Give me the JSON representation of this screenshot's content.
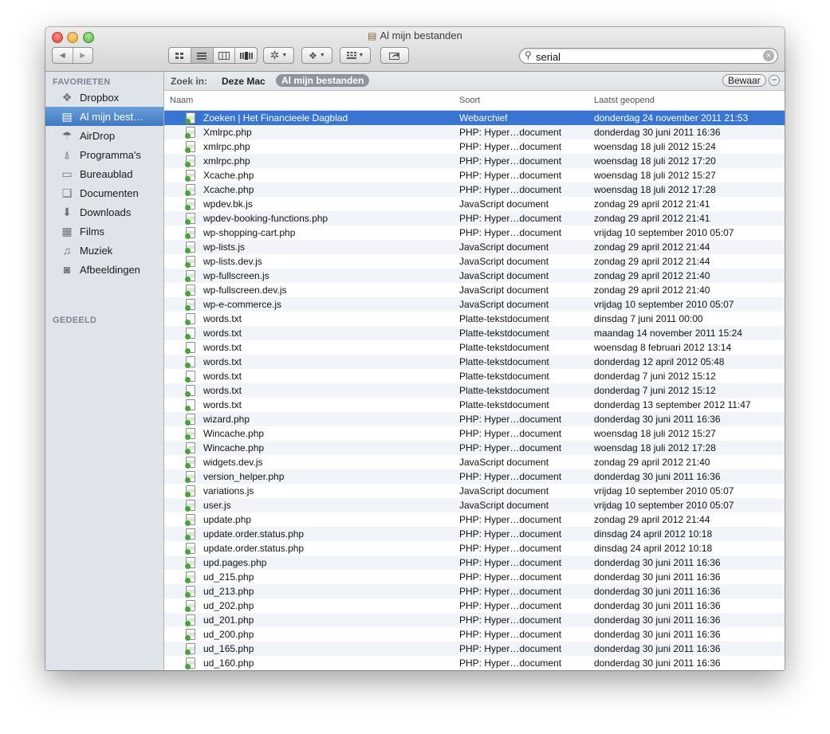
{
  "window": {
    "title": "Al mijn bestanden",
    "title_icon": "all-my-files-icon"
  },
  "toolbar": {
    "back": "◀",
    "forward": "▶",
    "view_icons": [
      "icon-view-icon",
      "list-view-icon",
      "column-view-icon",
      "coverflow-view-icon"
    ],
    "action": "action-gear-icon",
    "dropbox": "dropbox-icon",
    "arrange": "arrange-icon",
    "share": "share-icon"
  },
  "search": {
    "value": "serial",
    "placeholder": ""
  },
  "sidebar": {
    "favorites_header": "FAVORIETEN",
    "shared_header": "GEDEELD",
    "items": [
      {
        "label": "Dropbox",
        "icon": "dropbox-icon"
      },
      {
        "label": "Al mijn best…",
        "icon": "all-my-files-icon"
      },
      {
        "label": "AirDrop",
        "icon": "airdrop-icon"
      },
      {
        "label": "Programma's",
        "icon": "applications-icon"
      },
      {
        "label": "Bureaublad",
        "icon": "desktop-icon"
      },
      {
        "label": "Documenten",
        "icon": "documents-icon"
      },
      {
        "label": "Downloads",
        "icon": "downloads-icon"
      },
      {
        "label": "Films",
        "icon": "movies-icon"
      },
      {
        "label": "Muziek",
        "icon": "music-icon"
      },
      {
        "label": "Afbeeldingen",
        "icon": "pictures-icon"
      }
    ]
  },
  "scope": {
    "label": "Zoek in:",
    "option1": "Deze Mac",
    "option2": "Al mijn bestanden",
    "save": "Bewaar",
    "remove": "−"
  },
  "columns": {
    "name": "Naam",
    "kind": "Soort",
    "opened": "Laatst geopend"
  },
  "files": [
    {
      "name": "Zoeken | Het Financieele Dagblad",
      "kind": "Webarchief",
      "opened": "donderdag 24 november 2011 21:53"
    },
    {
      "name": "Xmlrpc.php",
      "kind": "PHP: Hyper…document",
      "opened": "donderdag 30 juni 2011 16:36"
    },
    {
      "name": "xmlrpc.php",
      "kind": "PHP: Hyper…document",
      "opened": "woensdag 18 juli 2012 15:24"
    },
    {
      "name": "xmlrpc.php",
      "kind": "PHP: Hyper…document",
      "opened": "woensdag 18 juli 2012 17:20"
    },
    {
      "name": "Xcache.php",
      "kind": "PHP: Hyper…document",
      "opened": "woensdag 18 juli 2012 15:27"
    },
    {
      "name": "Xcache.php",
      "kind": "PHP: Hyper…document",
      "opened": "woensdag 18 juli 2012 17:28"
    },
    {
      "name": "wpdev.bk.js",
      "kind": "JavaScript document",
      "opened": "zondag 29 april 2012 21:41"
    },
    {
      "name": "wpdev-booking-functions.php",
      "kind": "PHP: Hyper…document",
      "opened": "zondag 29 april 2012 21:41"
    },
    {
      "name": "wp-shopping-cart.php",
      "kind": "PHP: Hyper…document",
      "opened": "vrijdag 10 september 2010 05:07"
    },
    {
      "name": "wp-lists.js",
      "kind": "JavaScript document",
      "opened": "zondag 29 april 2012 21:44"
    },
    {
      "name": "wp-lists.dev.js",
      "kind": "JavaScript document",
      "opened": "zondag 29 april 2012 21:44"
    },
    {
      "name": "wp-fullscreen.js",
      "kind": "JavaScript document",
      "opened": "zondag 29 april 2012 21:40"
    },
    {
      "name": "wp-fullscreen.dev.js",
      "kind": "JavaScript document",
      "opened": "zondag 29 april 2012 21:40"
    },
    {
      "name": "wp-e-commerce.js",
      "kind": "JavaScript document",
      "opened": "vrijdag 10 september 2010 05:07"
    },
    {
      "name": "words.txt",
      "kind": "Platte-tekstdocument",
      "opened": "dinsdag 7 juni 2011 00:00"
    },
    {
      "name": "words.txt",
      "kind": "Platte-tekstdocument",
      "opened": "maandag 14 november 2011 15:24"
    },
    {
      "name": "words.txt",
      "kind": "Platte-tekstdocument",
      "opened": "woensdag 8 februari 2012 13:14"
    },
    {
      "name": "words.txt",
      "kind": "Platte-tekstdocument",
      "opened": "donderdag 12 april 2012 05:48"
    },
    {
      "name": "words.txt",
      "kind": "Platte-tekstdocument",
      "opened": "donderdag 7 juni 2012 15:12"
    },
    {
      "name": "words.txt",
      "kind": "Platte-tekstdocument",
      "opened": "donderdag 7 juni 2012 15:12"
    },
    {
      "name": "words.txt",
      "kind": "Platte-tekstdocument",
      "opened": "donderdag 13 september 2012 11:47"
    },
    {
      "name": "wizard.php",
      "kind": "PHP: Hyper…document",
      "opened": "donderdag 30 juni 2011 16:36"
    },
    {
      "name": "Wincache.php",
      "kind": "PHP: Hyper…document",
      "opened": "woensdag 18 juli 2012 15:27"
    },
    {
      "name": "Wincache.php",
      "kind": "PHP: Hyper…document",
      "opened": "woensdag 18 juli 2012 17:28"
    },
    {
      "name": "widgets.dev.js",
      "kind": "JavaScript document",
      "opened": "zondag 29 april 2012 21:40"
    },
    {
      "name": "version_helper.php",
      "kind": "PHP: Hyper…document",
      "opened": "donderdag 30 juni 2011 16:36"
    },
    {
      "name": "variations.js",
      "kind": "JavaScript document",
      "opened": "vrijdag 10 september 2010 05:07"
    },
    {
      "name": "user.js",
      "kind": "JavaScript document",
      "opened": "vrijdag 10 september 2010 05:07"
    },
    {
      "name": "update.php",
      "kind": "PHP: Hyper…document",
      "opened": "zondag 29 april 2012 21:44"
    },
    {
      "name": "update.order.status.php",
      "kind": "PHP: Hyper…document",
      "opened": "dinsdag 24 april 2012 10:18"
    },
    {
      "name": "update.order.status.php",
      "kind": "PHP: Hyper…document",
      "opened": "dinsdag 24 april 2012 10:18"
    },
    {
      "name": "upd.pages.php",
      "kind": "PHP: Hyper…document",
      "opened": "donderdag 30 juni 2011 16:36"
    },
    {
      "name": "ud_215.php",
      "kind": "PHP: Hyper…document",
      "opened": "donderdag 30 juni 2011 16:36"
    },
    {
      "name": "ud_213.php",
      "kind": "PHP: Hyper…document",
      "opened": "donderdag 30 juni 2011 16:36"
    },
    {
      "name": "ud_202.php",
      "kind": "PHP: Hyper…document",
      "opened": "donderdag 30 juni 2011 16:36"
    },
    {
      "name": "ud_201.php",
      "kind": "PHP: Hyper…document",
      "opened": "donderdag 30 juni 2011 16:36"
    },
    {
      "name": "ud_200.php",
      "kind": "PHP: Hyper…document",
      "opened": "donderdag 30 juni 2011 16:36"
    },
    {
      "name": "ud_165.php",
      "kind": "PHP: Hyper…document",
      "opened": "donderdag 30 juni 2011 16:36"
    },
    {
      "name": "ud_160.php",
      "kind": "PHP: Hyper…document",
      "opened": "donderdag 30 juni 2011 16:36"
    }
  ]
}
